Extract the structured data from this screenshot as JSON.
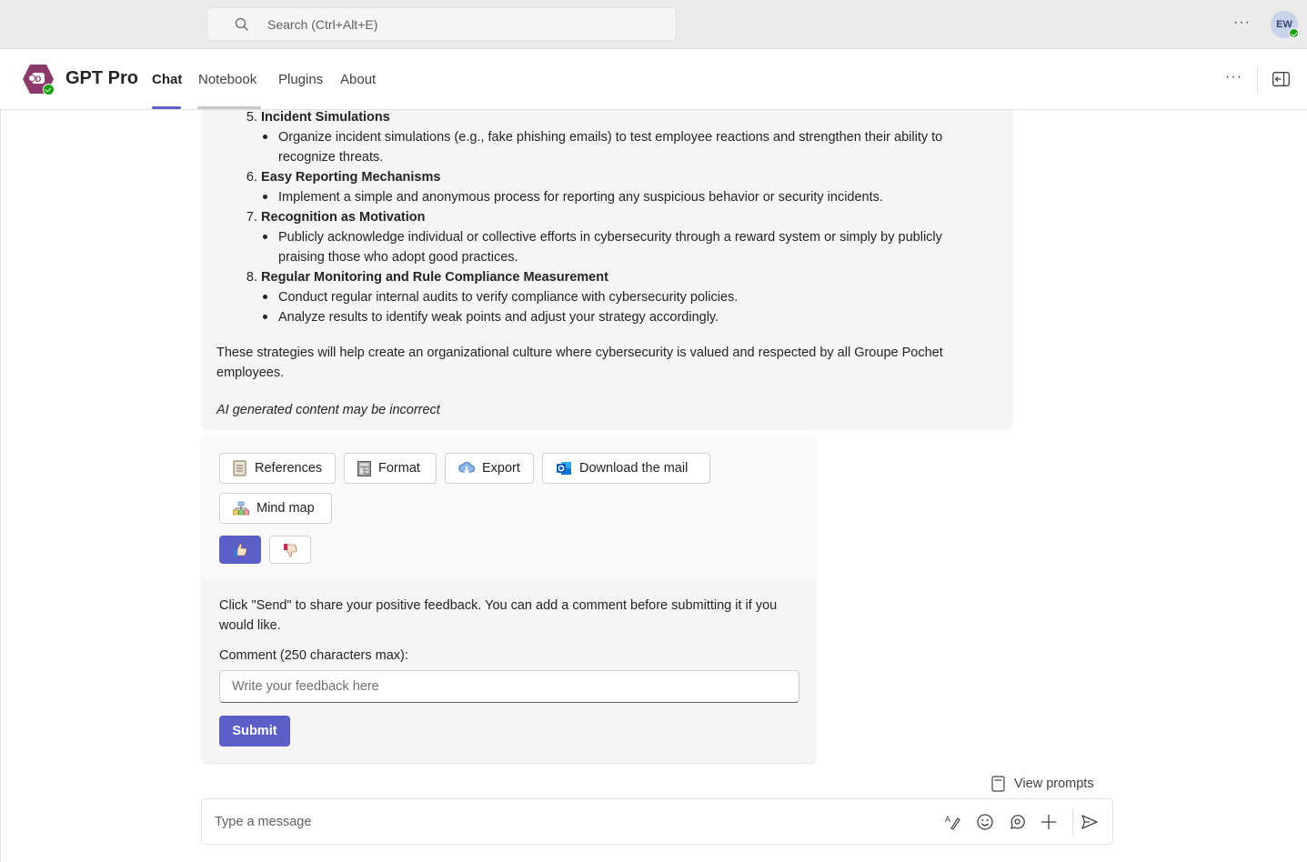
{
  "topbar": {
    "search_placeholder": "Search (Ctrl+Alt+E)",
    "more_label": "···",
    "avatar_initials": "EW",
    "avatar_status": "available"
  },
  "app": {
    "title": "GPT Pro",
    "tabs": [
      {
        "label": "Chat",
        "active": true
      },
      {
        "label": "Notebook",
        "active": false
      },
      {
        "label": "Plugins",
        "active": false
      },
      {
        "label": "About",
        "active": false
      }
    ],
    "more_label": "···",
    "accent_color": "#5b5fc7",
    "logo_color": "#8b3a6b"
  },
  "message": {
    "items": [
      {
        "number": "5.",
        "title": "Incident Simulations",
        "bullets": [
          "Organize incident simulations (e.g., fake phishing emails) to test employee reactions and strengthen their ability to recognize threats."
        ]
      },
      {
        "number": "6.",
        "title": "Easy Reporting Mechanisms",
        "bullets": [
          "Implement a simple and anonymous process for reporting any suspicious behavior or security incidents."
        ]
      },
      {
        "number": "7.",
        "title": "Recognition as Motivation",
        "bullets": [
          "Publicly acknowledge individual or collective efforts in cybersecurity through a reward system or simply by publicly praising those who adopt good practices."
        ]
      },
      {
        "number": "8.",
        "title": "Regular Monitoring and Rule Compliance Measurement",
        "bullets": [
          "Conduct regular internal audits to verify compliance with cybersecurity policies.",
          "Analyze results to identify weak points and adjust your strategy accordingly."
        ]
      }
    ],
    "conclusion": "These strategies will help create an organizational culture where cybersecurity is valued and respected by all Groupe Pochet employees.",
    "disclaimer": "AI generated content may be incorrect"
  },
  "card": {
    "actions": [
      {
        "label": "References",
        "icon": "document-icon"
      },
      {
        "label": "Format",
        "icon": "layout-icon"
      },
      {
        "label": "Export",
        "icon": "cloud-download-icon"
      },
      {
        "label": "Download the mail",
        "icon": "outlook-icon"
      },
      {
        "label": "Mind map",
        "icon": "org-chart-icon"
      }
    ],
    "thumbs_up_selected": true,
    "feedback_text": "Click \"Send\" to share your positive feedback. You can add a comment before submitting it if you would like.",
    "comment_label": "Comment (250 characters max):",
    "comment_placeholder": "Write your feedback here",
    "comment_value": "",
    "submit_label": "Submit"
  },
  "compose": {
    "view_prompts_label": "View prompts",
    "placeholder": "Type a message"
  }
}
